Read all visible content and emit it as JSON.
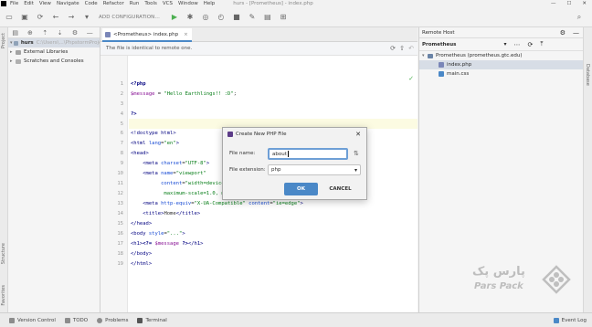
{
  "menu": [
    "File",
    "Edit",
    "View",
    "Navigate",
    "Code",
    "Refactor",
    "Run",
    "Tools",
    "VCS",
    "Window",
    "Help"
  ],
  "window_title": "hurs - [Prometheus] - index.php",
  "toolbar": {
    "add_configuration": "ADD CONFIGURATION..."
  },
  "project": {
    "root": "hurs",
    "root_path": "C:\\Users\\...\\PhpstormProjects\\hurs",
    "items": [
      "External Libraries",
      "Scratches and Consoles"
    ]
  },
  "editor": {
    "tab_label": "<Prometheus> index.php",
    "notice": "The file is identical to remote one.",
    "line_numbers": [
      "1",
      "2",
      "3",
      "4",
      "5",
      "6",
      "7",
      "8",
      "9",
      "10",
      "11",
      "12",
      "13",
      "14",
      "15",
      "16",
      "17",
      "18",
      "19"
    ]
  },
  "remote": {
    "title": "Remote Host",
    "server": "Prometheus",
    "root": "Prometheus (prometheus.gtc.edu)",
    "files": [
      "index.php",
      "main.css"
    ]
  },
  "dialog": {
    "title": "Create New PHP File",
    "file_name_label": "File name:",
    "file_name_value": "about",
    "extension_label": "File extension:",
    "extension_value": "php",
    "ok": "OK",
    "cancel": "CANCEL"
  },
  "left_tabs": [
    "Project",
    "Structure",
    "Favorites"
  ],
  "right_tabs": [
    "Database"
  ],
  "statusbar": {
    "items": [
      "Version Control",
      "TODO",
      "Problems",
      "Terminal"
    ],
    "event_log": "Event Log"
  },
  "watermark": {
    "text": "Pars Pack",
    "text_fa": "پارس پک"
  },
  "colors": {
    "accent": "#4a88c7",
    "php_icon": "#7a86b8"
  }
}
